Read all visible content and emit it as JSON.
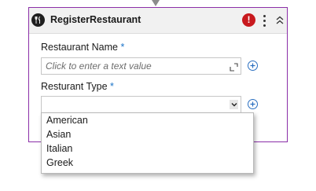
{
  "activity": {
    "title": "RegisterRestaurant",
    "icon": "restaurant-cutlery-icon",
    "error_icon_glyph": "!",
    "accent_color": "#8b2fa8",
    "error_color": "#c8191e"
  },
  "fields": [
    {
      "label": "Restaurant Name",
      "required_mark": "*",
      "value": "",
      "placeholder": "Click to enter a text value"
    },
    {
      "label": "Resturant Type",
      "required_mark": "*",
      "value": ""
    }
  ],
  "dropdown": {
    "options": [
      "American",
      "Asian",
      "Italian",
      "Greek"
    ]
  }
}
